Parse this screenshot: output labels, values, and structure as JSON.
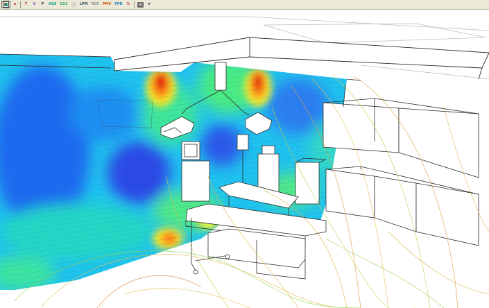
{
  "toolbar": {
    "tools": [
      {
        "label": "",
        "icon": "render-mode-icon",
        "pressed": true
      },
      {
        "label": "",
        "icon": "probe-icon",
        "pressed": false
      },
      {
        "label": "T",
        "color": "#c0392b"
      },
      {
        "label": "V",
        "color": "#8e44ad"
      },
      {
        "label": "P",
        "color": "#2c3e50"
      },
      {
        "label": "AGE",
        "color": "#16a085"
      },
      {
        "label": "CO2",
        "color": "#27ae60"
      },
      {
        "label": "",
        "icon": "blank-icon"
      },
      {
        "label": "LPM",
        "color": "#34495e"
      },
      {
        "label": "RCE",
        "color": "#7f8c8d"
      },
      {
        "label": "PMV",
        "color": "#d35400"
      },
      {
        "label": "PPD",
        "color": "#2980b9"
      },
      {
        "label": "%",
        "color": "#c0392b"
      },
      {
        "label": "",
        "icon": "camera-icon"
      },
      {
        "label": "",
        "icon": "settings-icon"
      }
    ]
  },
  "scene": {
    "background": "#ffffff",
    "line_color": "#2b2b2b",
    "contour_palette": [
      "#1f3fe0",
      "#1aa3ff",
      "#22e0d0",
      "#55ef70",
      "#e6f233",
      "#ff9a1e",
      "#e01a12"
    ]
  }
}
